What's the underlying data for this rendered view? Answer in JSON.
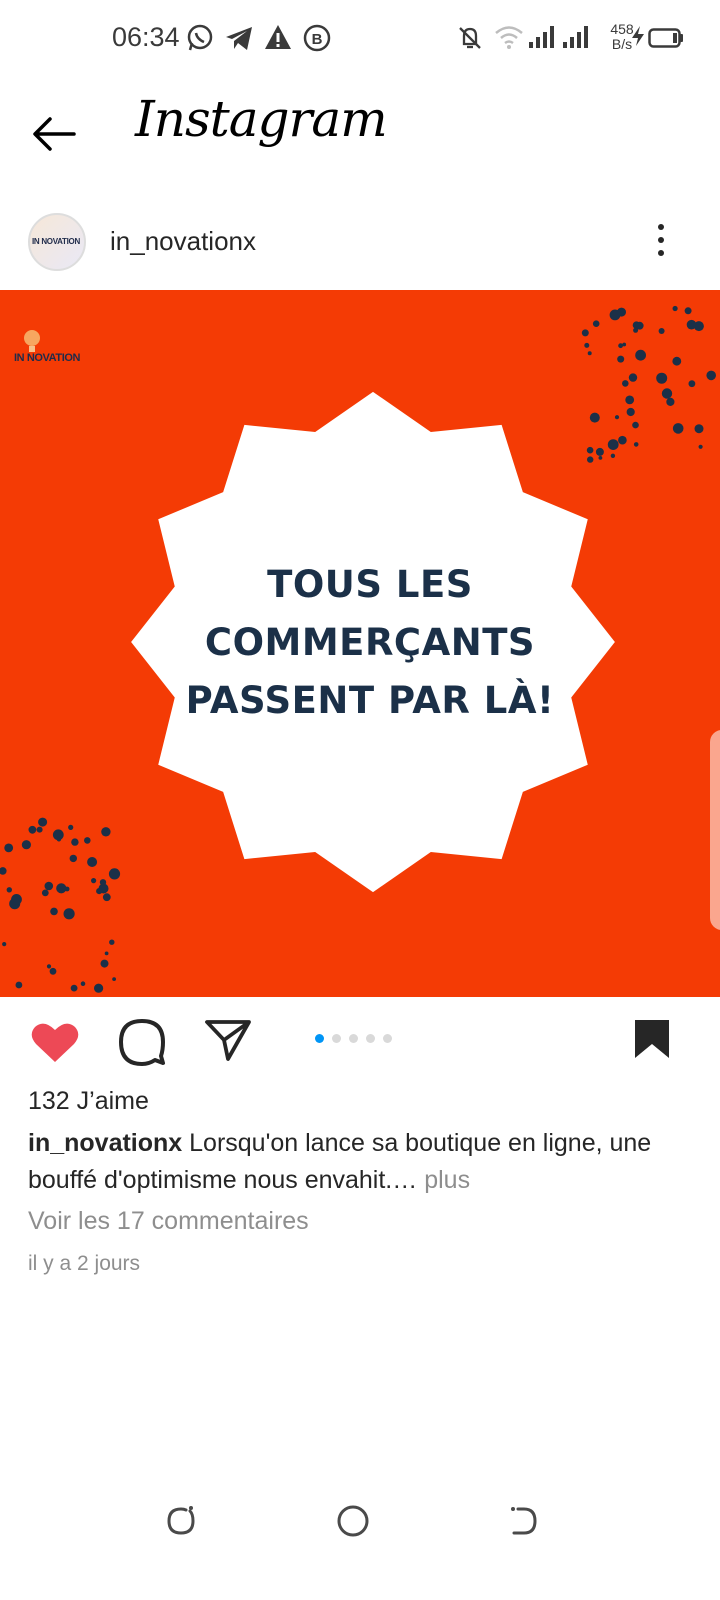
{
  "status_bar": {
    "time": "06:34",
    "net_speed_value": "458",
    "net_speed_unit": "B/s",
    "icons": [
      "whatsapp-icon",
      "telegram-icon",
      "warning-icon",
      "b-badge-icon",
      "mute-bell-icon",
      "wifi-icon",
      "signal-icon",
      "signal-icon",
      "charging-icon",
      "battery-icon"
    ]
  },
  "header": {
    "app_name": "Instagram"
  },
  "post": {
    "username": "in_novationx",
    "avatar_text": "IN NOVATION",
    "brand_text": "IN NOVATION",
    "image_headline": [
      "TOUS LES",
      "COMMERÇANTS",
      "PASSENT PAR LÀ!"
    ],
    "image_background": "#f43b05",
    "carousel_pages": 5,
    "carousel_active": 1,
    "likes": "132 J’aime",
    "caption_username": "in_novationx",
    "caption_text": "Lorsqu'on lance sa boutique en ligne, une bouffé d'optimisme nous envahit.…",
    "caption_more": "plus",
    "comments_link": "Voir les 17 commentaires",
    "time_ago": "il y a 2 jours"
  },
  "colors": {
    "like_red": "#ed4956",
    "accent_blue": "#0095f6",
    "text": "#262626",
    "muted": "#8e8e8e"
  }
}
